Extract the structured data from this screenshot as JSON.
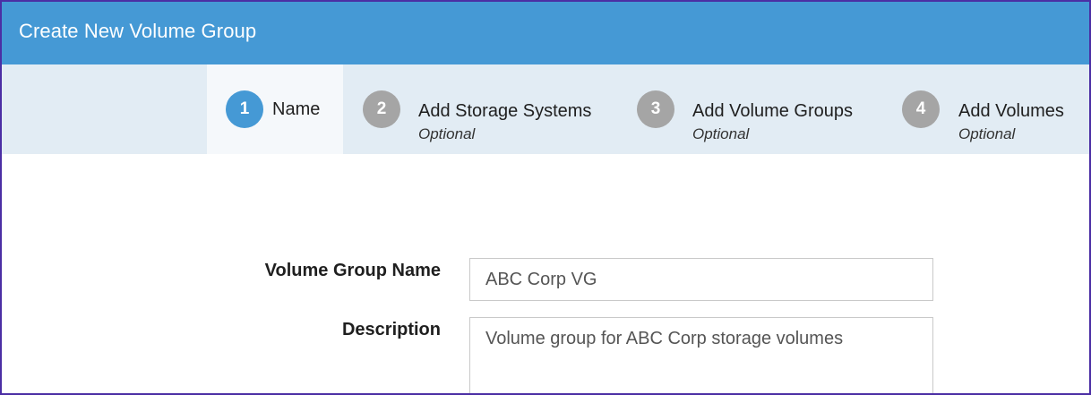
{
  "dialog": {
    "title": "Create New Volume Group"
  },
  "steps": [
    {
      "number": "1",
      "label": "Name",
      "sublabel": "",
      "active": true
    },
    {
      "number": "2",
      "label": "Add Storage Systems",
      "sublabel": "Optional",
      "active": false
    },
    {
      "number": "3",
      "label": "Add Volume Groups",
      "sublabel": "Optional",
      "active": false
    },
    {
      "number": "4",
      "label": "Add Volumes",
      "sublabel": "Optional",
      "active": false
    }
  ],
  "form": {
    "name_label": "Volume Group Name",
    "name_value": "ABC Corp VG",
    "description_label": "Description",
    "description_value": "Volume group for ABC Corp storage volumes"
  },
  "colors": {
    "header": "#4599d5",
    "active_step": "#4599d5",
    "inactive_step": "#a5a5a5",
    "steps_background": "#e2ecf4",
    "border": "#4b2ea4"
  }
}
